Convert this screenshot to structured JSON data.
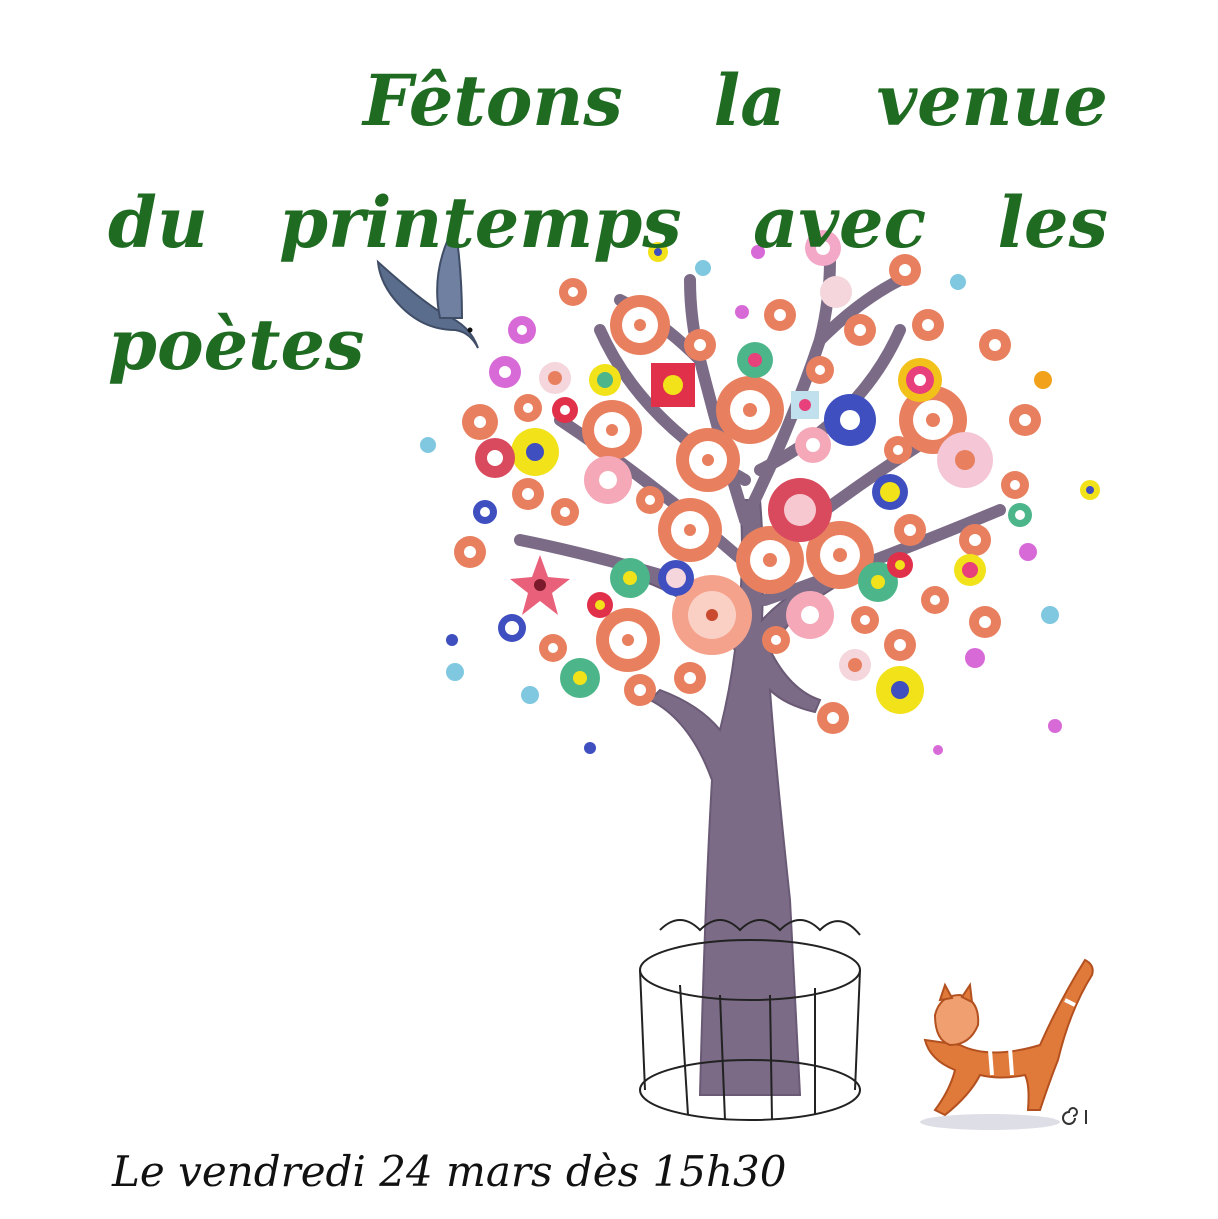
{
  "title": {
    "line1": [
      "Fêtons",
      "la",
      "venue"
    ],
    "line2": [
      "du",
      "printemps",
      "avec",
      "les"
    ],
    "line3": [
      "poètes"
    ]
  },
  "date_text": "Le vendredi 24 mars dès 15h30",
  "colors": {
    "title": "#1f6b22",
    "date": "#111111",
    "trunk": "#7b6b86",
    "flower_orange": "#e8805f",
    "bird": "#5b6d8c",
    "cat": "#e07a3a"
  }
}
